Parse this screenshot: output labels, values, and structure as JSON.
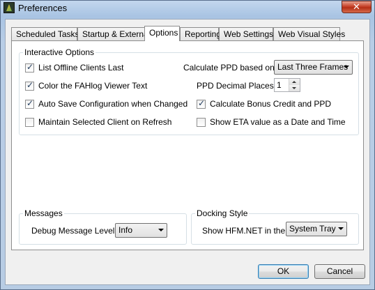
{
  "window": {
    "title": "Preferences",
    "close_label": "✕"
  },
  "tabs": [
    {
      "label": "Scheduled Tasks"
    },
    {
      "label": "Startup & External"
    },
    {
      "label": "Options",
      "active": true
    },
    {
      "label": "Reporting"
    },
    {
      "label": "Web Settings"
    },
    {
      "label": "Web Visual Styles"
    }
  ],
  "interactive_options": {
    "title": "Interactive Options",
    "checkboxes": [
      {
        "label": "List Offline Clients Last",
        "checked": true
      },
      {
        "label": "Color the FAHlog Viewer Text",
        "checked": true
      },
      {
        "label": "Auto Save Configuration when Changed",
        "checked": true
      },
      {
        "label": "Maintain Selected Client on Refresh",
        "checked": false
      }
    ],
    "ppd_label": "Calculate PPD based on:",
    "ppd_value": "Last Three Frames",
    "decimal_label": "PPD Decimal Places:",
    "decimal_value": "1",
    "bonus_label": "Calculate Bonus Credit and PPD",
    "bonus_checked": true,
    "eta_label": "Show ETA value as a Date and Time",
    "eta_checked": false
  },
  "messages": {
    "title": "Messages",
    "debug_label": "Debug Message Level:",
    "debug_value": "Info"
  },
  "docking": {
    "title": "Docking Style",
    "show_label": "Show HFM.NET in the:",
    "show_value": "System Tray"
  },
  "buttons": {
    "ok": "OK",
    "cancel": "Cancel"
  },
  "colors": {
    "window_frame": "#b9cfe6",
    "close_button": "#c7432b",
    "checkmark": "#1e395b"
  }
}
